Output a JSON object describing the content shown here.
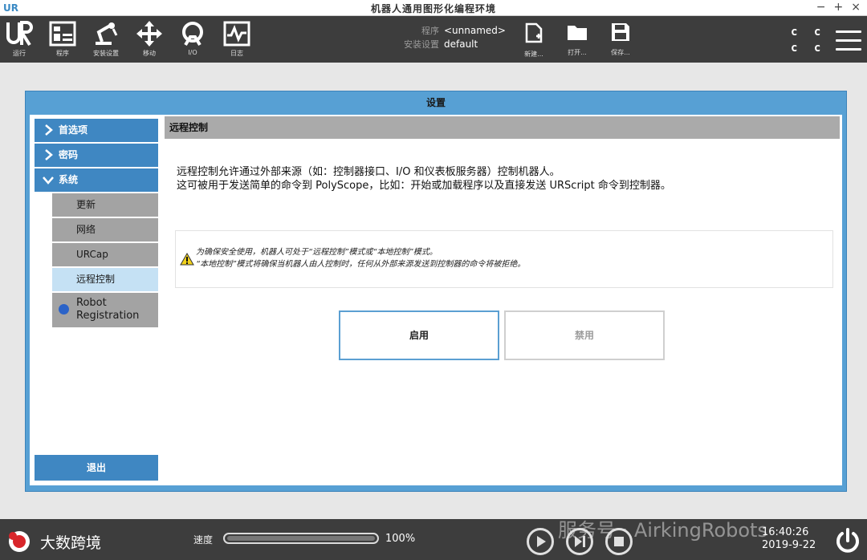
{
  "window": {
    "title": "机器人通用图形化编程环境",
    "controls": [
      "−",
      "+",
      "×"
    ]
  },
  "toolbar": {
    "tabs": [
      {
        "label": "运行",
        "icon": "ur-logo-icon"
      },
      {
        "label": "程序",
        "icon": "program-icon"
      },
      {
        "label": "安装设置",
        "icon": "robot-arm-icon"
      },
      {
        "label": "移动",
        "icon": "move-arrows-icon"
      },
      {
        "label": "I/O",
        "icon": "io-icon"
      },
      {
        "label": "日志",
        "icon": "log-icon"
      }
    ],
    "program_key": "程序",
    "program_value": "<unnamed>",
    "installation_key": "安装设置",
    "installation_value": "default",
    "file_buttons": [
      {
        "label": "新建...",
        "icon": "new-file-icon"
      },
      {
        "label": "打开...",
        "icon": "folder-icon"
      },
      {
        "label": "保存...",
        "icon": "save-icon"
      }
    ],
    "status_cc": [
      "c c",
      "c c"
    ]
  },
  "dialog": {
    "title": "设置",
    "sidebar": {
      "items": [
        {
          "label": "首选项",
          "expanded": false
        },
        {
          "label": "密码",
          "expanded": false
        },
        {
          "label": "系统",
          "expanded": true
        }
      ],
      "sub_items": [
        {
          "label": "更新"
        },
        {
          "label": "网络"
        },
        {
          "label": "URCap"
        },
        {
          "label": "远程控制",
          "selected": true
        },
        {
          "label": "Robot Registration"
        }
      ],
      "exit_label": "退出"
    },
    "content": {
      "header": "远程控制",
      "description_line1": "远程控制允许通过外部来源（如：控制器接口、I/O 和仪表板服务器）控制机器人。",
      "description_line2": "这可被用于发送简单的命令到 PolyScope，比如：开始或加载程序以及直接发送 URScript 命令到控制器。",
      "warning_line1": "为确保安全使用，机器人可处于“远程控制”模式或“本地控制”模式。",
      "warning_line2": "“本地控制”模式将确保当机器人由人控制时，任何从外部来源发送到控制器的命令将被拒绝。",
      "enable_label": "启用",
      "disable_label": "禁用"
    }
  },
  "footer": {
    "brand": "大数跨境",
    "speed_label": "速度",
    "speed_value": "100%",
    "speed_fraction": 1.0,
    "watermark": "服务号 · AirkingRobots",
    "time": "16:40:26",
    "date": "2019-9-22"
  },
  "colors": {
    "accent": "#3f87c2",
    "dialog_frame": "#57a0d4",
    "selected_item": "#c5e1f4",
    "toolbar_bg": "#3d3d3d"
  }
}
